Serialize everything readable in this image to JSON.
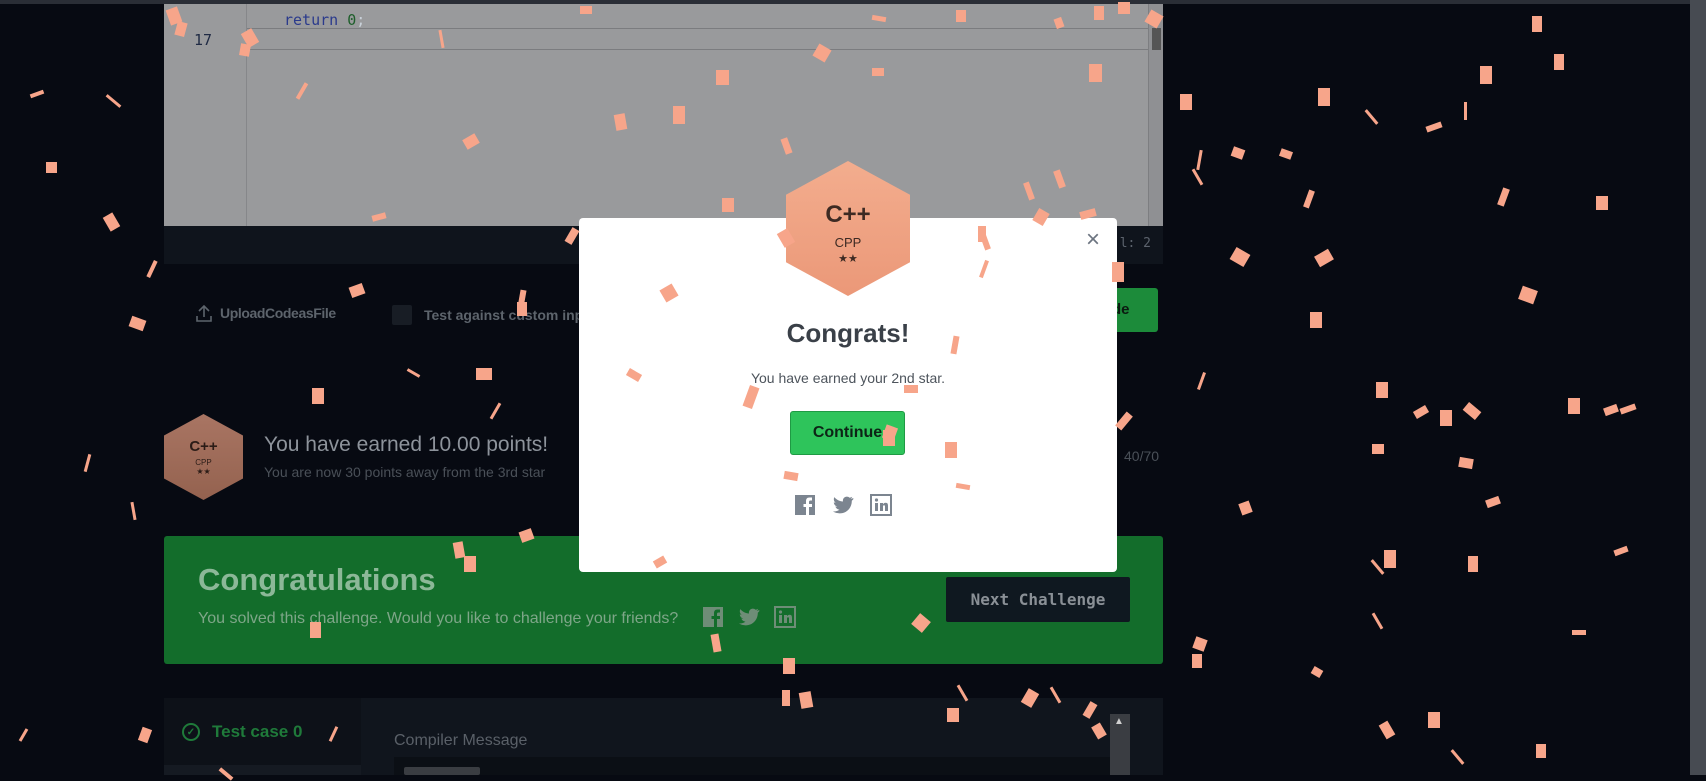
{
  "editor": {
    "lines": [
      {
        "number": "",
        "keyword": "return",
        "value": "0",
        "end": ";"
      },
      {
        "number": "17",
        "keyword": "",
        "value": "",
        "end": ""
      }
    ],
    "cursor_position": "l: 2"
  },
  "actions": {
    "upload_label": "UploadCodeasFile",
    "custom_input_label": "Test against custom inp",
    "submit_label": "de"
  },
  "points": {
    "badge_logo": "C++",
    "badge_lang": "CPP",
    "badge_stars": "★★",
    "earned_text": "You have earned 10.00 points!",
    "remaining_text": "You are now 30 points away from the 3rd star",
    "progress": "40/70"
  },
  "banner": {
    "title": "Congratulations",
    "subtitle": "You solved this challenge. Would you like to challenge your friends?",
    "next_label": "Next Challenge"
  },
  "tests": {
    "case_label": "Test case 0",
    "compiler_label": "Compiler Message"
  },
  "modal": {
    "close": "×",
    "badge_logo": "C++",
    "badge_lang": "CPP",
    "badge_stars": "★★",
    "title": "Congrats!",
    "subtitle": "You have earned your 2nd star.",
    "continue_label": "Continue"
  },
  "colors": {
    "accent_green": "#2ec45b",
    "banner_green": "#136d2b",
    "confetti": "#f7a58a",
    "badge_bronze": "#eb9878"
  }
}
